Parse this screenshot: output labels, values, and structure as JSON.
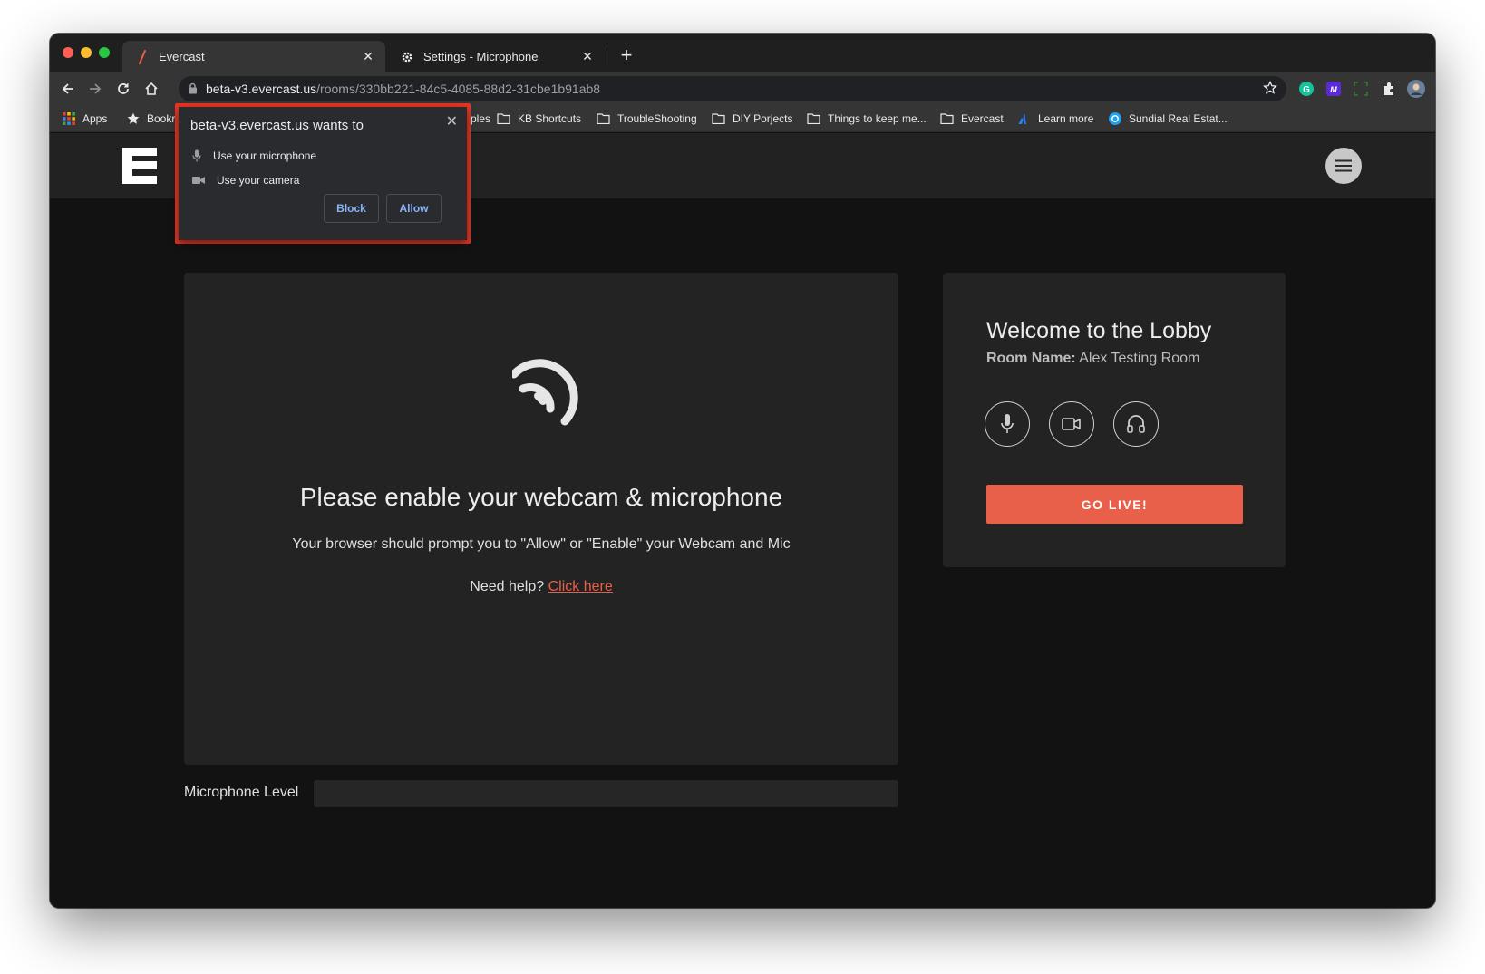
{
  "browser": {
    "tabs": [
      {
        "title": "Evercast",
        "active": true
      },
      {
        "title": "Settings - Microphone",
        "active": false
      }
    ],
    "url": {
      "host": "beta-v3.evercast.us",
      "path": "/rooms/330bb221-84c5-4085-88d2-31cbe1b91ab8"
    },
    "bookmarks": [
      {
        "label": "Apps",
        "icon": "apps-grid-icon"
      },
      {
        "label": "Bookr",
        "icon": "star-icon"
      },
      {
        "label": "mples",
        "icon": "folder-icon"
      },
      {
        "label": "KB Shortcuts",
        "icon": "folder-icon"
      },
      {
        "label": "TroubleShooting",
        "icon": "folder-icon"
      },
      {
        "label": "DIY Porjects",
        "icon": "folder-icon"
      },
      {
        "label": "Things to keep me...",
        "icon": "folder-icon"
      },
      {
        "label": "Evercast",
        "icon": "folder-icon"
      },
      {
        "label": "Learn more",
        "icon": "atlassian-icon"
      },
      {
        "label": "Sundial Real Estat...",
        "icon": "sundial-icon"
      }
    ]
  },
  "permission_prompt": {
    "title": "beta-v3.evercast.us wants to",
    "items": [
      {
        "label": "Use your microphone",
        "icon": "microphone-icon"
      },
      {
        "label": "Use your camera",
        "icon": "camera-icon"
      }
    ],
    "block_label": "Block",
    "allow_label": "Allow"
  },
  "main": {
    "title": "Please enable your webcam & microphone",
    "subtitle": "Your browser should prompt you to \"Allow\" or \"Enable\" your Webcam and Mic",
    "help_prefix": "Need help? ",
    "help_link": "Click here",
    "mic_label": "Microphone Level",
    "mic_level": 0
  },
  "lobby": {
    "title": "Welcome to the Lobby",
    "room_label": "Room Name:",
    "room_name": " Alex Testing Room",
    "go_live_label": "GO LIVE!"
  },
  "colors": {
    "accent": "#e8604a",
    "highlight_outline": "#ea3323",
    "link_blue": "#8ab4f8"
  }
}
